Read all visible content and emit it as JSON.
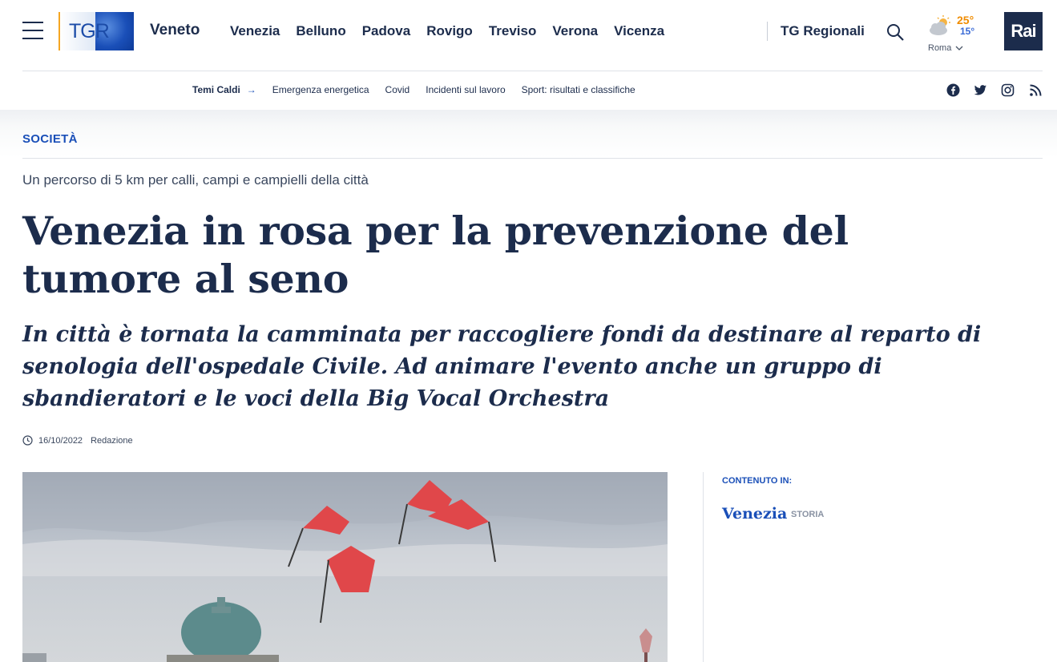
{
  "header": {
    "region": "Veneto",
    "logo_text": "TGR",
    "nav_items": [
      "Venezia",
      "Belluno",
      "Padova",
      "Rovigo",
      "Treviso",
      "Verona",
      "Vicenza"
    ],
    "tg_regionali": "TG Regionali",
    "weather": {
      "temp_max": "25°",
      "temp_min": "15°",
      "city": "Roma",
      "icon": "partly-cloudy-icon"
    },
    "rai_logo": "Rai"
  },
  "subnav": {
    "hot_label": "Temi Caldi",
    "topics": [
      "Emergenza energetica",
      "Covid",
      "Incidenti sul lavoro",
      "Sport: risultati e classifiche"
    ],
    "social": [
      "facebook-icon",
      "twitter-icon",
      "instagram-icon",
      "rss-icon"
    ]
  },
  "article": {
    "section": "SOCIETÀ",
    "overline": "Un percorso di 5 km per calli, campi e campielli della città",
    "title": "Venezia in rosa per la prevenzione del tumore al seno",
    "subtitle": "In città è tornata la camminata per raccogliere fondi da destinare al reparto di senologia dell'ospedale Civile. Ad animare l'evento anche un gruppo di sbandieratori e le voci della Big Vocal Orchestra",
    "date": "16/10/2022",
    "author": "Redazione"
  },
  "sidebar": {
    "label": "CONTENUTO IN:",
    "city": "Venezia",
    "tag": "STORIA"
  },
  "colors": {
    "navy": "#1c2c4c",
    "accent_blue": "#1a4fb8",
    "logo_orange": "#f5a623",
    "flag_red": "#e0474a"
  }
}
